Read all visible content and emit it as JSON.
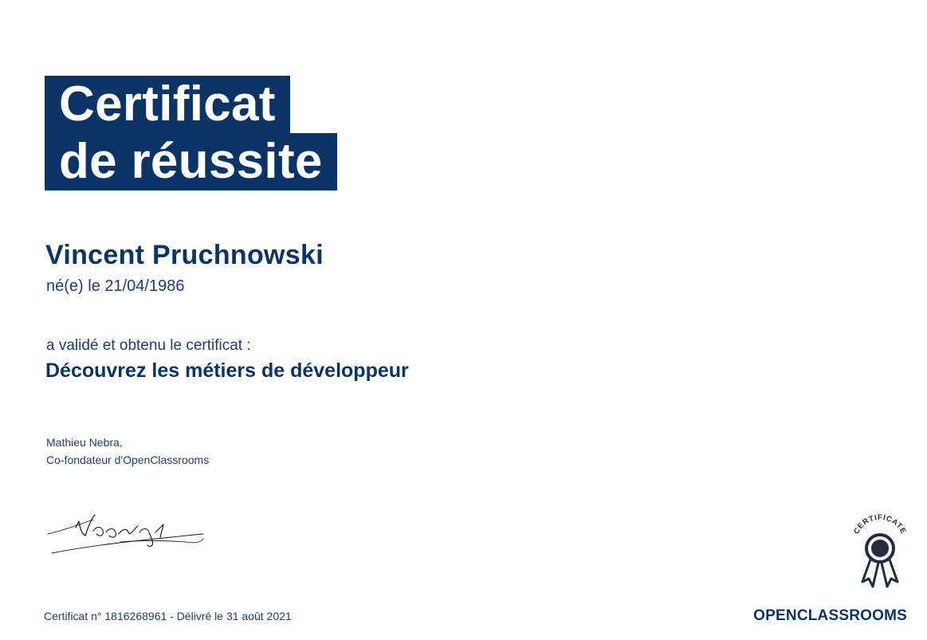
{
  "certificate": {
    "title_line1": "Certificat",
    "title_line2": "de réussite",
    "recipient_name": "Vincent Pruchnowski",
    "birth_text": "né(e) le 21/04/1986",
    "validated_text": "a validé et obtenu le certificat :",
    "course_name": "Découvrez les métiers de développeur",
    "signer_name": "Mathieu Nebra,",
    "signer_title": "Co-fondateur d'OpenClassrooms",
    "footer_text": "Certificat n° 1816268961 - Délivré le 31 août 2021"
  },
  "seal": {
    "label": "CERTIFICATE",
    "icon": "award-ribbon-icon"
  },
  "logo": {
    "text": "OPENCLASSROOMS"
  },
  "colors": {
    "primary": "#0b3466",
    "text": "#1a3f6f",
    "background": "#ffffff"
  }
}
